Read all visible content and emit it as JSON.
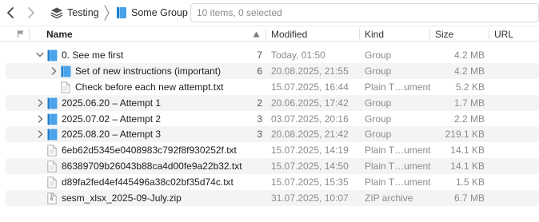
{
  "toolbar": {
    "breadcrumb_root": "Testing",
    "breadcrumb_current": "Some Group",
    "item_count": "10 items, 0 selected"
  },
  "columns": {
    "name": "Name",
    "modified": "Modified",
    "kind": "Kind",
    "size": "Size",
    "url": "URL"
  },
  "rows": [
    {
      "name": "0. See me first",
      "count": "7",
      "modified": "Today, 01:50",
      "kind": "Group",
      "size": "4.2 MB",
      "icon": "group-icon",
      "indent": 1,
      "expanded": true
    },
    {
      "name": "Set of new instructions (important)",
      "count": "6",
      "modified": "20.08.2025, 21:55",
      "kind": "Group",
      "size": "4.2 MB",
      "icon": "group-icon",
      "indent": 2,
      "expanded": false
    },
    {
      "name": "Check before each new attempt.txt",
      "count": "",
      "modified": "15.07.2025, 16:44",
      "kind": "Plain T…ument",
      "size": "5.2 KB",
      "icon": "document-icon",
      "indent": 2,
      "expanded": null
    },
    {
      "name": "2025.06.20 – Attempt 1",
      "count": "2",
      "modified": "20.06.2025, 17:42",
      "kind": "Group",
      "size": "1.7 MB",
      "icon": "group-icon",
      "indent": 0,
      "expanded": false
    },
    {
      "name": "2025.07.02 – Attempt 2",
      "count": "3",
      "modified": "03.07.2025, 20:16",
      "kind": "Group",
      "size": "2.2 MB",
      "icon": "group-icon",
      "indent": 0,
      "expanded": false
    },
    {
      "name": "2025.08.20 – Attempt 3",
      "count": "3",
      "modified": "20.08.2025, 21:42",
      "kind": "Group",
      "size": "219.1 KB",
      "icon": "group-icon",
      "indent": 0,
      "expanded": false
    },
    {
      "name": "6eb62d5345e0408983c792f8f930252f.txt",
      "count": "",
      "modified": "15.07.2025, 14:19",
      "kind": "Plain T…ument",
      "size": "14.1 KB",
      "icon": "document-icon",
      "indent": 0,
      "expanded": null
    },
    {
      "name": "86389709b26043b88ca4d00fe9a22b32.txt",
      "count": "",
      "modified": "15.07.2025, 14:50",
      "kind": "Plain T…ument",
      "size": "14.1 KB",
      "icon": "document-icon",
      "indent": 0,
      "expanded": null
    },
    {
      "name": "d89fa2fed4ef445496a38c02bf35d74c.txt",
      "count": "",
      "modified": "15.07.2025, 15:35",
      "kind": "Plain T…ument",
      "size": "1.5 KB",
      "icon": "document-icon",
      "indent": 0,
      "expanded": null
    },
    {
      "name": "sesm_xlsx_2025-09-July.zip",
      "count": "",
      "modified": "31.07.2025, 10:07",
      "kind": "ZIP archive",
      "size": "6.7 MB",
      "icon": "zip-file-icon",
      "indent": 0,
      "expanded": null
    }
  ]
}
